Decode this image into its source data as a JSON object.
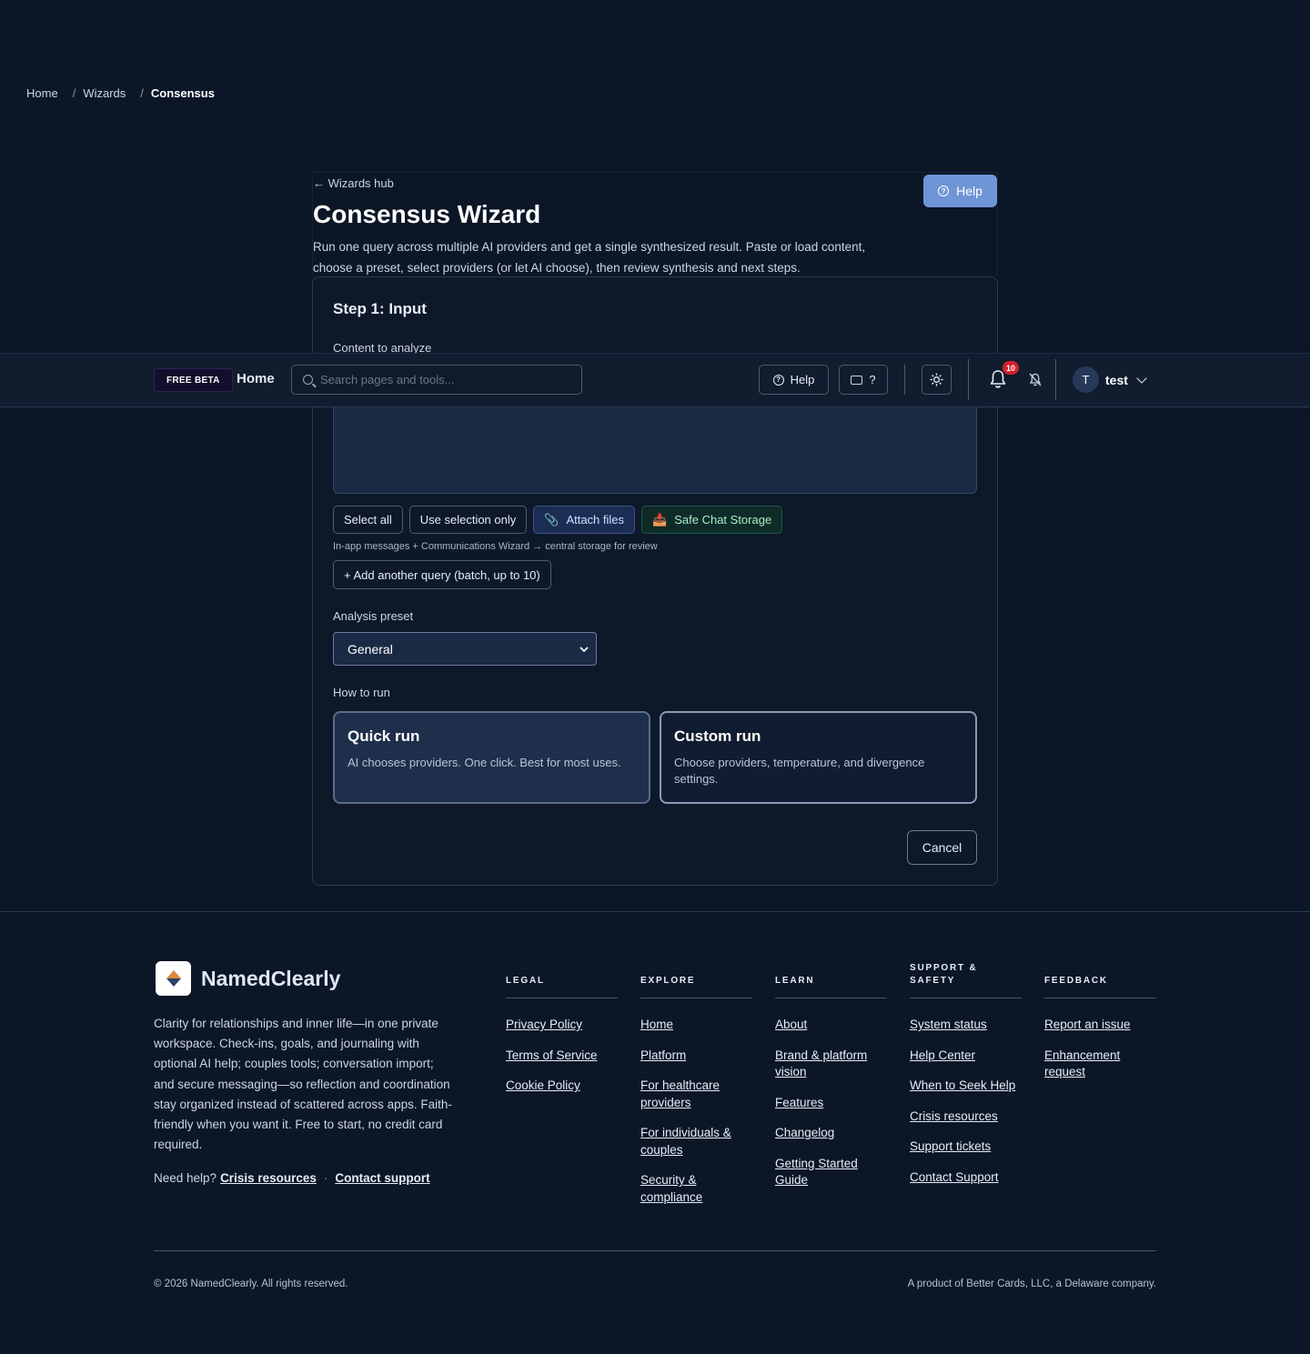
{
  "breadcrumb": {
    "items": [
      "Home",
      "Wizards",
      "Consensus"
    ],
    "separator": "/"
  },
  "wizard": {
    "back_link": "← Wizards hub",
    "title": "Consensus Wizard",
    "description": "Run one query across multiple AI providers and get a single synthesized result. Paste or load content, choose a preset, select providers (or let AI choose), then review synthesis and next steps.",
    "help_label": "Help"
  },
  "step": {
    "title": "Step 1: Input",
    "content_label": "Content to analyze",
    "buttons": {
      "select_all": "Select all",
      "use_selection": "Use selection only",
      "attach": "Attach files",
      "safe_storage": "Safe Chat Storage"
    },
    "storage_note": "In-app messages + Communications Wizard → central storage for review",
    "batch_button": "+ Add another query (batch, up to 10)",
    "preset_label": "Analysis preset",
    "preset_value": "General",
    "run_label": "How to run",
    "quick_run": {
      "title": "Quick run",
      "desc": "AI chooses providers. One click. Best for most uses."
    },
    "custom_run": {
      "title": "Custom run",
      "desc": "Choose providers, temperature, and divergence settings."
    },
    "cancel": "Cancel"
  },
  "header": {
    "beta_badge": "FREE BETA",
    "home": "Home",
    "search_placeholder": "Search pages and tools...",
    "help": "Help",
    "shortcuts": "?",
    "notification_count": "10",
    "user_initial": "T",
    "user_name": "test"
  },
  "footer": {
    "brand": "NamedClearly",
    "description": "Clarity for relationships and inner life—in one private workspace. Check-ins, goals, and journaling with optional AI help; couples tools; conversation import; and secure messaging—so reflection and coordination stay organized instead of scattered across apps. Faith-friendly when you want it. Free to start, no credit card required.",
    "need_help": "Need help?",
    "crisis_link": "Crisis resources",
    "contact_link": "Contact support",
    "columns": [
      {
        "head": "LEGAL",
        "links": [
          "Privacy Policy",
          "Terms of Service",
          "Cookie Policy"
        ]
      },
      {
        "head": "EXPLORE",
        "links": [
          "Home",
          "Platform",
          "For healthcare providers",
          "For individuals & couples",
          "Security & compliance"
        ]
      },
      {
        "head": "LEARN",
        "links": [
          "About",
          "Brand & platform vision",
          "Features",
          "Changelog",
          "Getting Started Guide"
        ]
      },
      {
        "head": "SUPPORT & SAFETY",
        "links": [
          "System status",
          "Help Center",
          "When to Seek Help",
          "Crisis resources",
          "Support tickets",
          "Contact Support"
        ]
      },
      {
        "head": "FEEDBACK",
        "links": [
          "Report an issue",
          "Enhancement request"
        ]
      }
    ],
    "copyright": "© 2026 NamedClearly. All rights reserved.",
    "product_of": "A product of Better Cards, LLC, a Delaware company."
  },
  "colors": {
    "background": "#0b1627",
    "accent_help": "#6f95d6",
    "badge_red": "#d61f2c",
    "safe_green": "#a8ecc8"
  }
}
